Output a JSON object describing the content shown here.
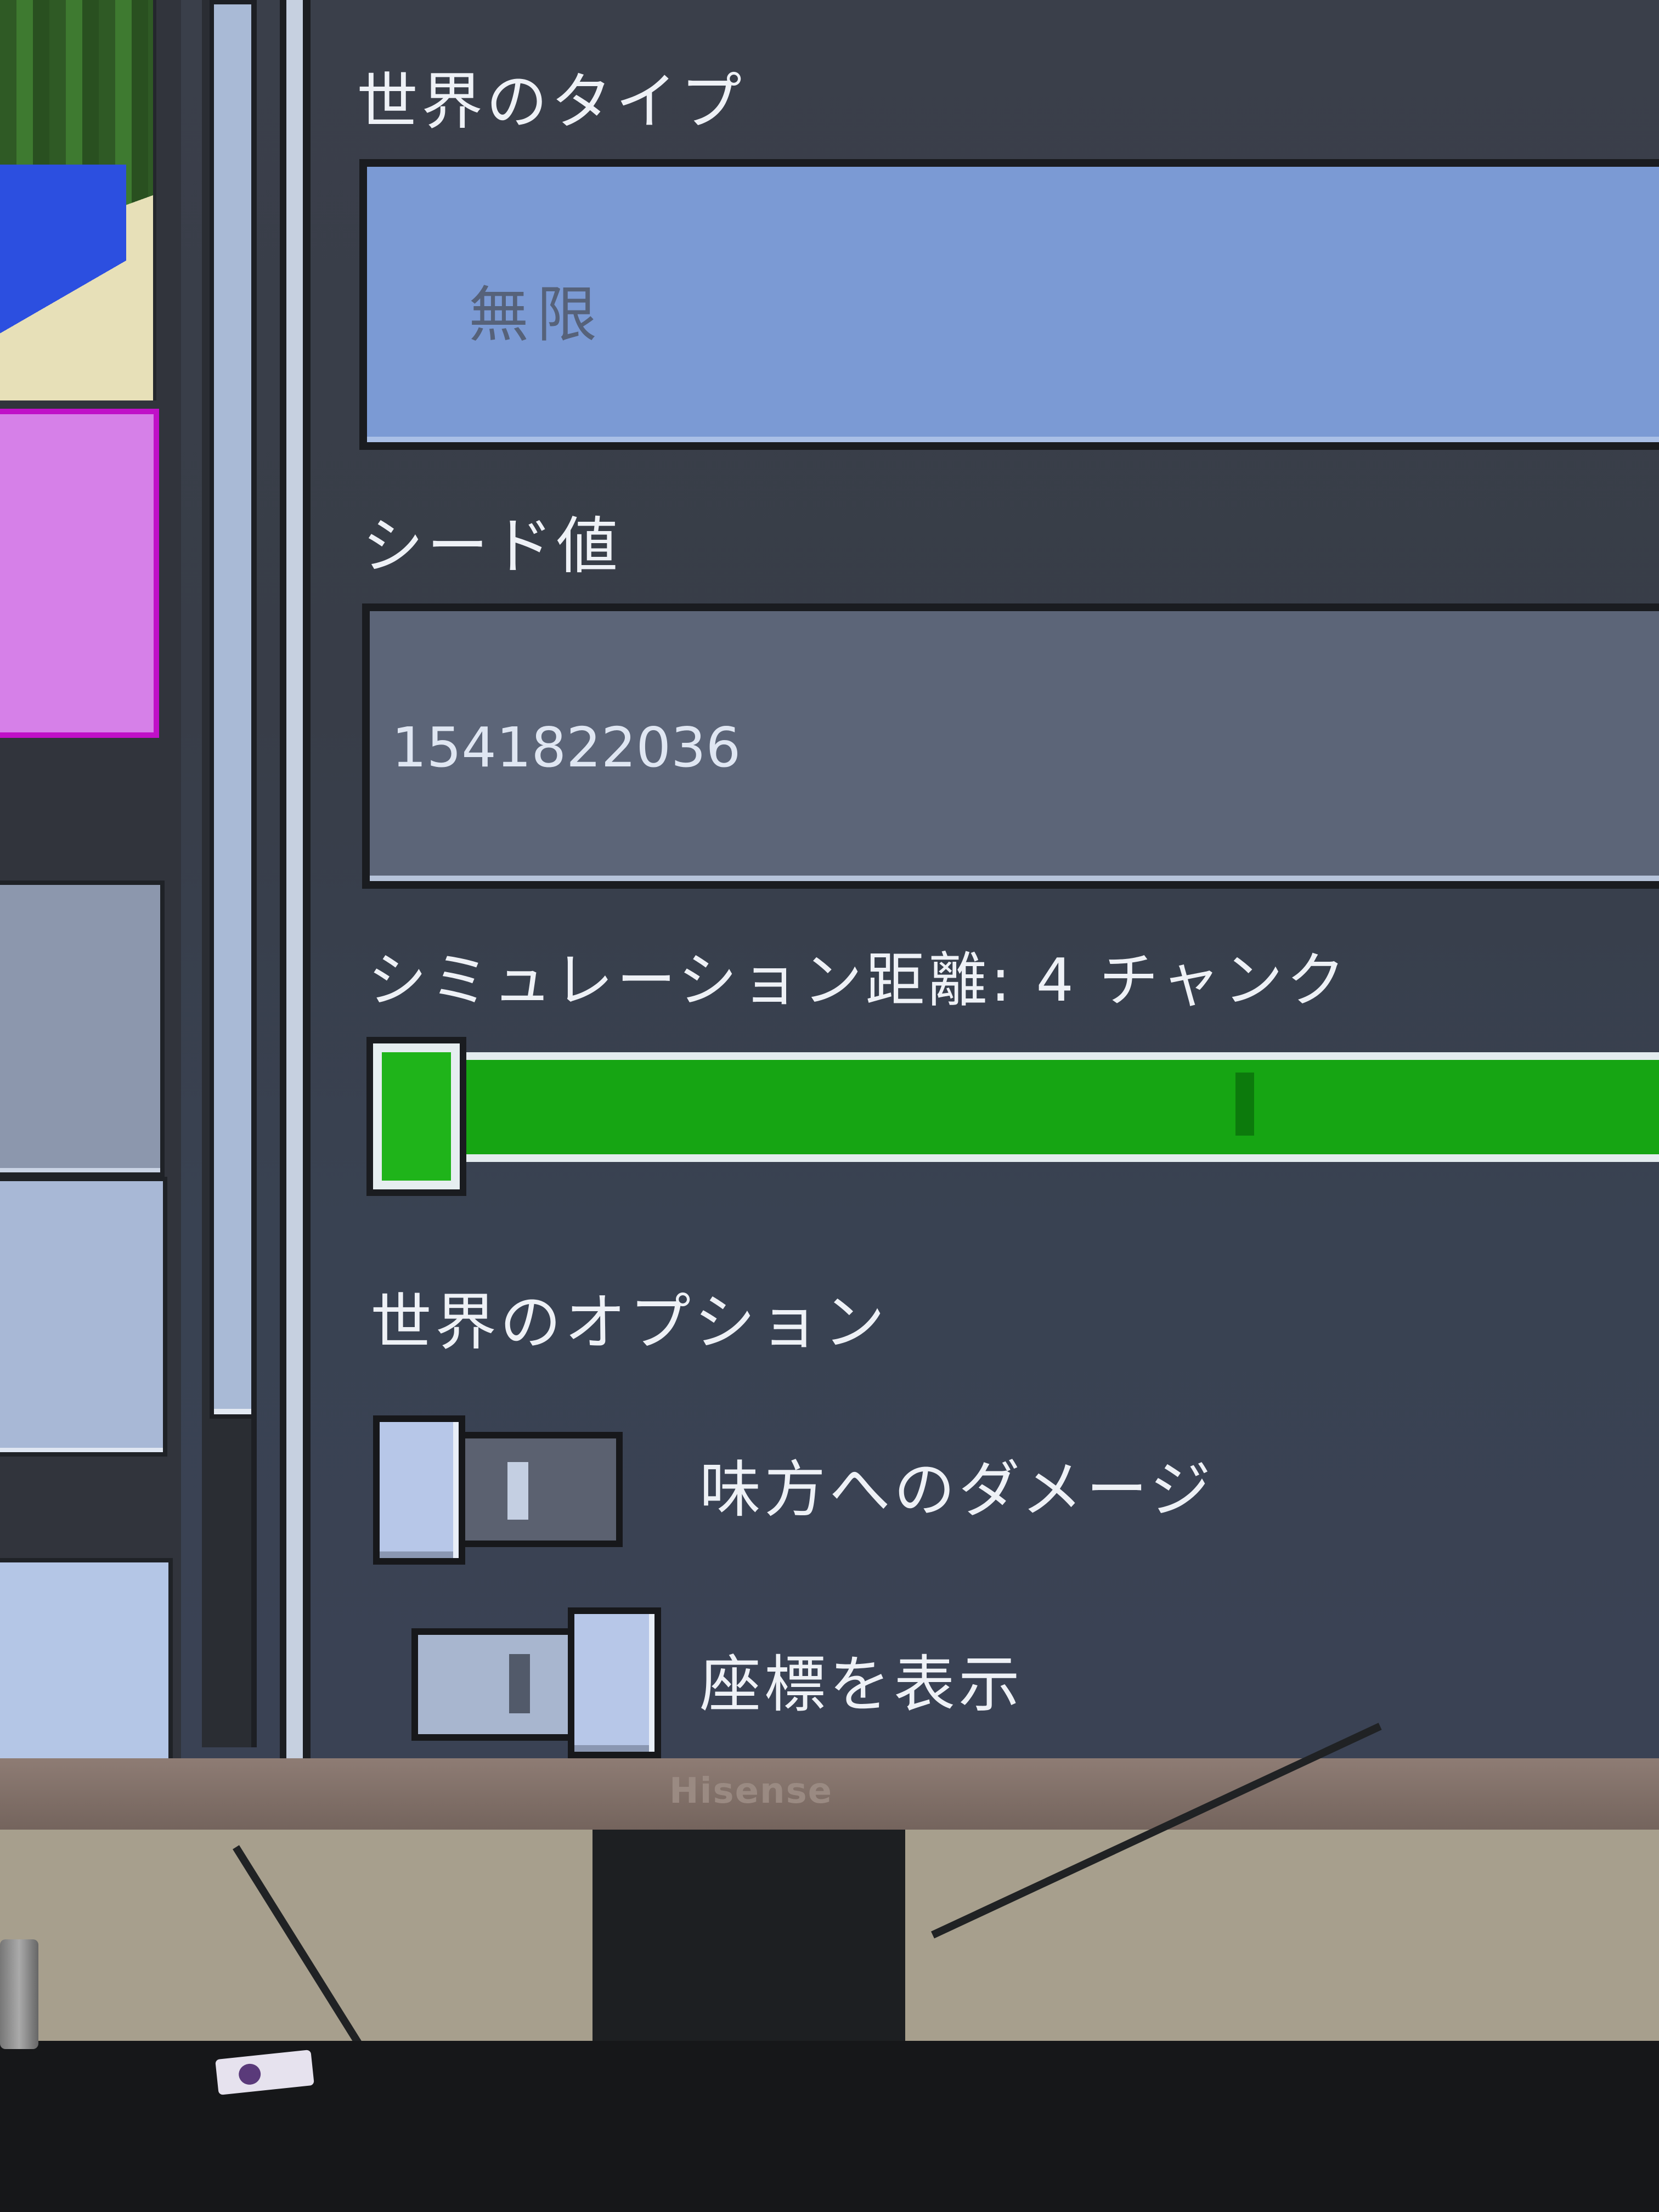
{
  "world_settings": {
    "world_type": {
      "label": "世界のタイプ",
      "value": "無限"
    },
    "seed": {
      "label": "シード値",
      "value": "1541822036"
    },
    "simulation_distance": {
      "label": "シミュレーション距離: 4 チャンク",
      "fraction": 0.0
    },
    "world_options": {
      "heading": "世界のオプション",
      "friendly_fire": {
        "label": "味方へのダメージ",
        "on": false
      },
      "show_coordinates": {
        "label": "座標を表示",
        "on": true
      }
    }
  },
  "monitor": {
    "brand": "Hisense"
  },
  "colors": {
    "accent_green": "#1fb41a",
    "panel_bg": "#3a3f4a",
    "field_blue": "#7b9ad4"
  }
}
